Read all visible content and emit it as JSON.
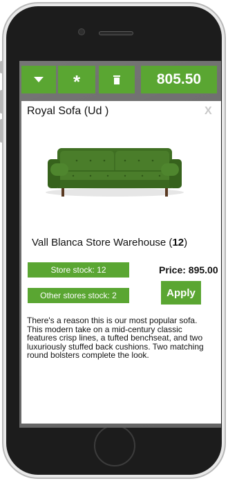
{
  "toolbar": {
    "menu_icon": "triangle-down-icon",
    "star_icon": "asterisk-icon",
    "star_label": "*",
    "delete_icon": "trash-icon",
    "total": "805.50"
  },
  "product": {
    "title": "Royal Sofa (Ud )",
    "close_label": "X",
    "image_icon": "green-velvet-sofa-image",
    "warehouse_name": "Vall Blanca Store Warehouse (",
    "warehouse_count": "12",
    "warehouse_close": ")",
    "store_stock": "Store stock: 12",
    "other_stock": "Other stores stock: 2",
    "price": "Price: 895.00",
    "apply_label": "Apply",
    "description": "There's a reason this is our most popular sofa. This modern take on a mid-century classic features crisp lines, a tufted benchseat, and two luxuriously stuffed back cushions. Two matching round bolsters complete the look."
  },
  "colors": {
    "accent": "#5aa632",
    "screen_bg": "#6d6d6d",
    "sofa": "#3f6f22"
  }
}
